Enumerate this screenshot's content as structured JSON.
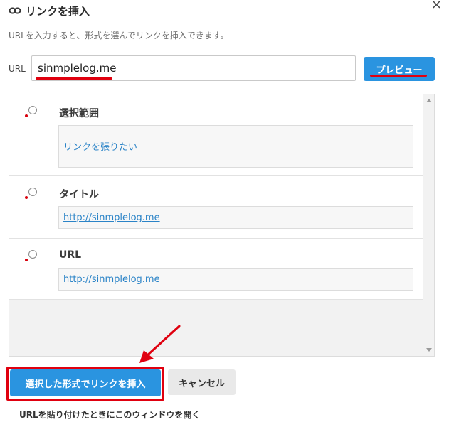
{
  "dialog": {
    "title": "リンクを挿入",
    "title_icon": "link-icon",
    "close_icon": "close-icon",
    "close_glyph": "×",
    "description": "URLを入力すると、形式を選んでリンクを挿入できます。"
  },
  "url": {
    "label": "URL",
    "value": "sinmplelog.me",
    "preview_button": "プレビュー"
  },
  "options": [
    {
      "label": "選択範囲",
      "preview_text": "リンクを張りたい"
    },
    {
      "label": "タイトル",
      "preview_text": "http://sinmplelog.me"
    },
    {
      "label": "URL",
      "preview_text": "http://sinmplelog.me"
    }
  ],
  "actions": {
    "insert_button": "選択した形式でリンクを挿入",
    "cancel_button": "キャンセル"
  },
  "auto_open": {
    "label": "URLを貼り付けたときにこのウィンドウを開く",
    "checked": false
  },
  "colors": {
    "accent": "#2a94e0",
    "annotation_red": "#e0000f",
    "link": "#2a83c7"
  }
}
